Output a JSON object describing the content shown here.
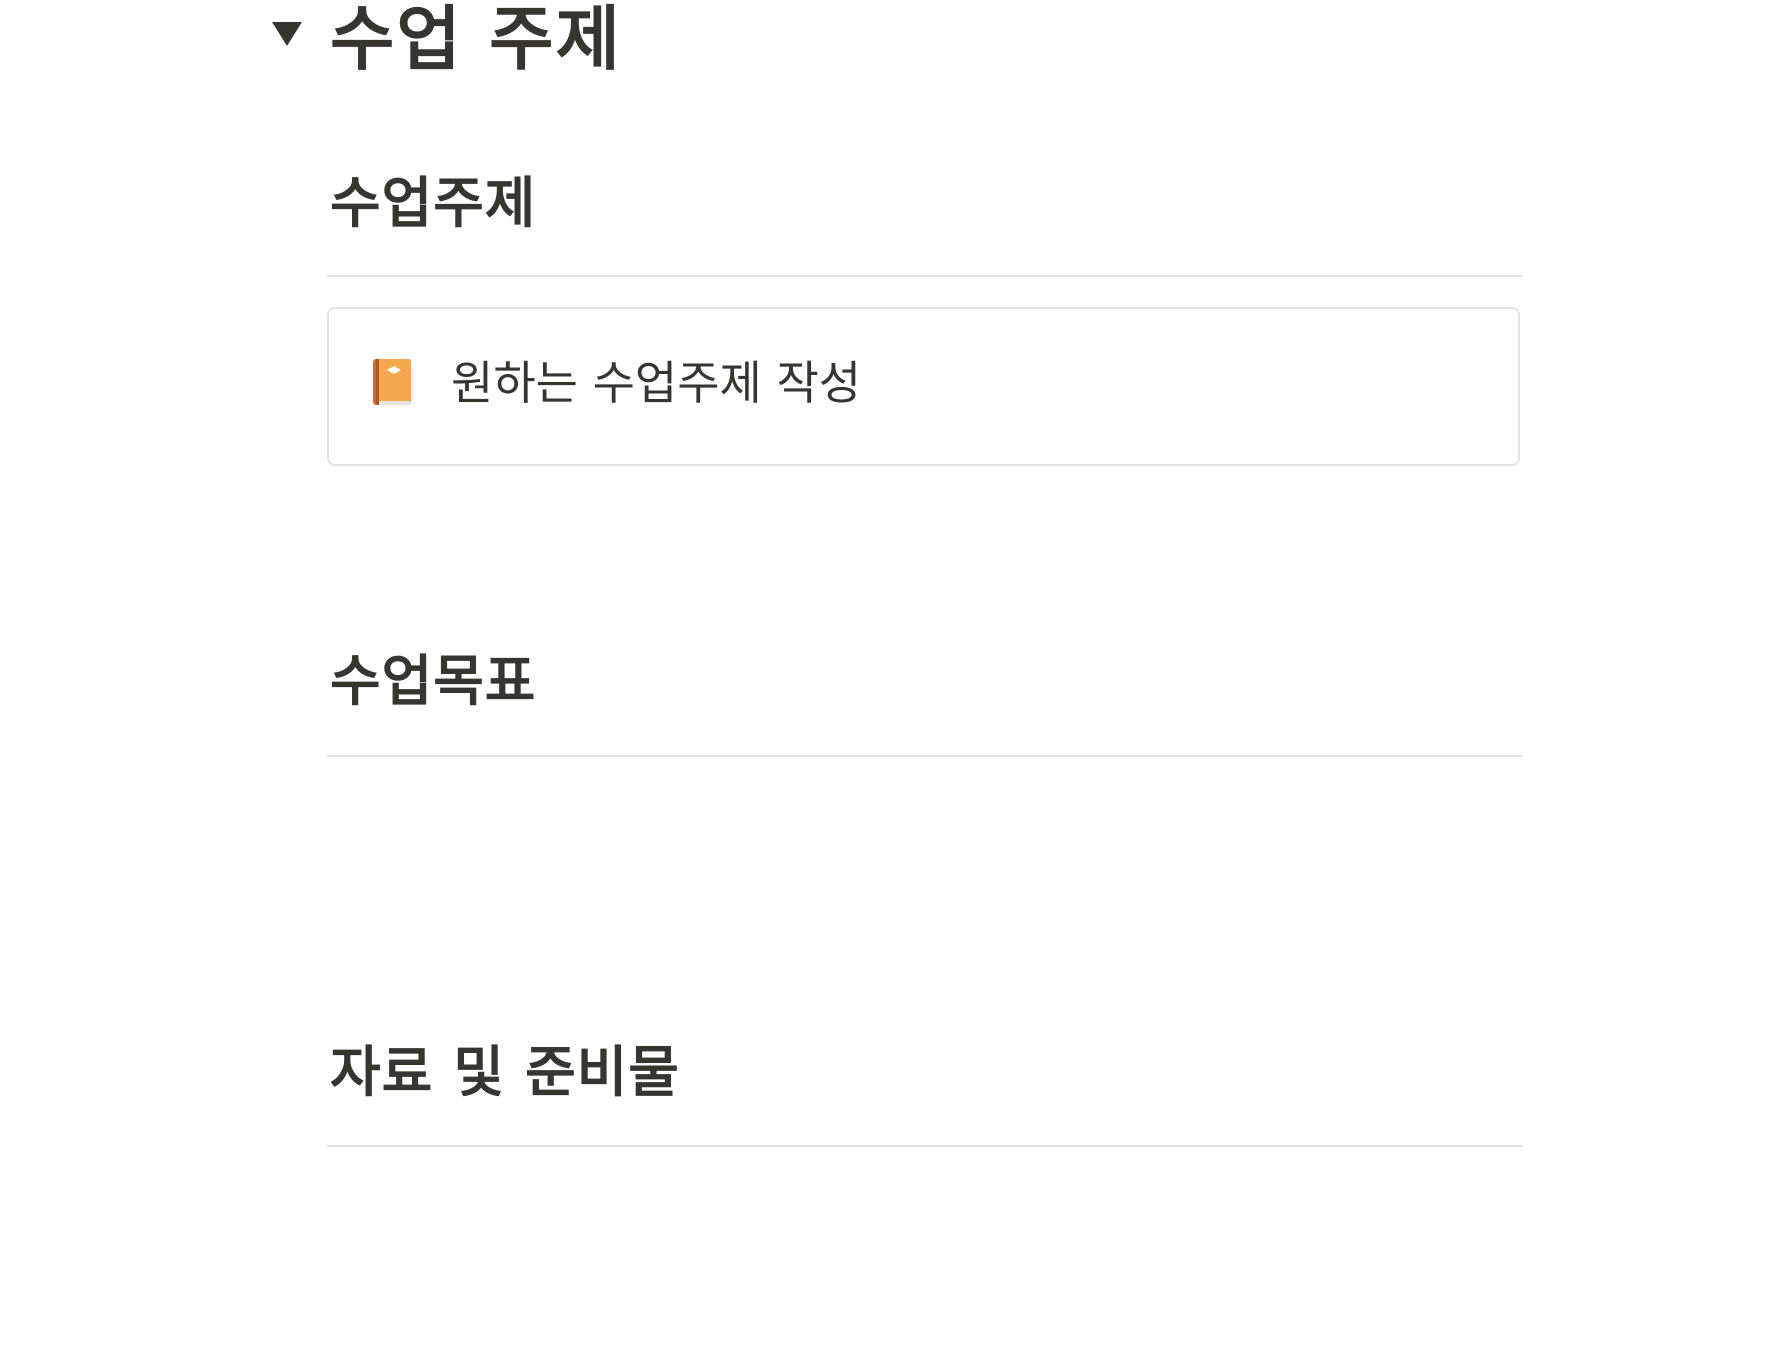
{
  "toggle": {
    "title": "수업 주제",
    "expanded": true
  },
  "sections": {
    "topic": {
      "heading": "수업주제",
      "callout": {
        "icon": "orange-book-icon",
        "text": "원하는 수업주제 작성"
      }
    },
    "goal": {
      "heading": "수업목표"
    },
    "materials": {
      "heading": "자료 및 준비물"
    }
  },
  "colors": {
    "text": "#37352f",
    "divider": "#e3e2e0",
    "book_cover": "#f5a84f",
    "book_spine": "#c8702a"
  }
}
